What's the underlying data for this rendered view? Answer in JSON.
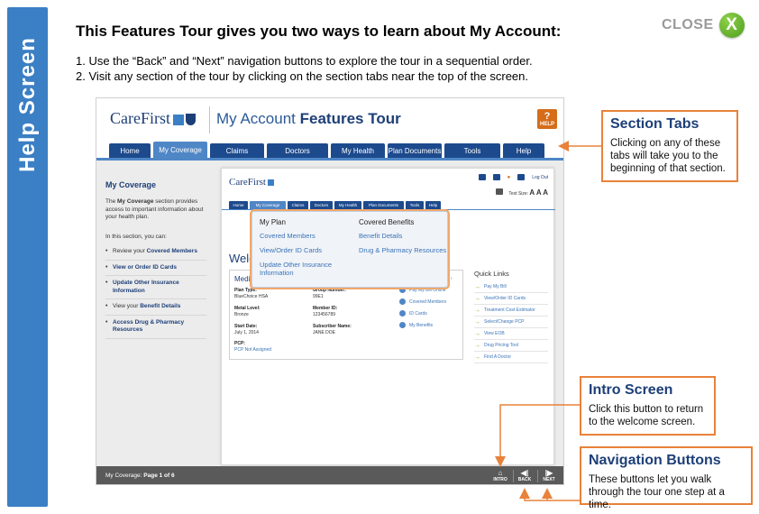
{
  "sidebar": {
    "vertical_title": "Help Screen"
  },
  "close": {
    "label": "CLOSE",
    "icon_glyph": "X"
  },
  "headline": "This Features Tour gives you two ways to learn about  My Account:",
  "instructions": [
    "1. Use the “Back” and “Next” navigation buttons to explore the tour in a sequential order.",
    "2. Visit any section of the tour by clicking on the section tabs near the top of the screen."
  ],
  "screenshot": {
    "logo": "CareFirst",
    "title_light": "My Account ",
    "title_bold": "Features Tour",
    "help_label": "HELP",
    "help_glyph": "?",
    "tabs": [
      {
        "label": "Home",
        "width": 46
      },
      {
        "label": "My Coverage",
        "width": 60,
        "active": true
      },
      {
        "label": "Claims",
        "width": 60
      },
      {
        "label": "Doctors",
        "width": 68
      },
      {
        "label": "My Health",
        "width": 60
      },
      {
        "label": "Plan Documents",
        "width": 60
      },
      {
        "label": "Tools",
        "width": 62
      },
      {
        "label": "Help",
        "width": 46
      }
    ],
    "left_panel": {
      "title": "My Coverage",
      "desc_prefix": "The ",
      "desc_bold": "My Coverage",
      "desc_suffix": " section provides access to important information about your health plan.",
      "can_text": "In this section, you can:",
      "bullets": [
        {
          "prefix": "Review your ",
          "bold": "Covered Members"
        },
        {
          "prefix": "",
          "bold": "View or Order ID Cards"
        },
        {
          "prefix": "",
          "bold": "Update Other Insurance Information"
        },
        {
          "prefix": "View your ",
          "bold": "Benefit Details"
        },
        {
          "prefix": "",
          "bold": "Access Drug & Pharmacy Resources"
        }
      ]
    },
    "mock": {
      "logo": "CareFirst",
      "logout": "Log Out",
      "text_size_label": "Text Size:",
      "text_size_values": "A A A",
      "tabs": [
        "Home",
        "My Coverage",
        "Claims",
        "Doctors",
        "My Health",
        "Plan Documents",
        "Tools",
        "Help"
      ],
      "dropdown": {
        "col1_head": "My Plan",
        "col1_links": [
          "Covered Members",
          "View/Order ID Cards",
          "Update Other Insurance Information"
        ],
        "col2_head": "Covered Benefits",
        "col2_links": [
          "Benefit Details",
          "Drug & Pharmacy Resources"
        ]
      },
      "welcome": "Welc",
      "card_title": "Medi",
      "card_more": "ails ›",
      "fields": [
        {
          "label": "Plan Type:",
          "value": "BlueChoice HSA"
        },
        {
          "label": "Group Number:",
          "value": "99E1"
        },
        {
          "label": "Metal Level:",
          "value": "Bronze"
        },
        {
          "label": "Member ID:",
          "value": "123456789"
        },
        {
          "label": "Start Date:",
          "value": "July 1, 2014"
        },
        {
          "label": "Subscriber Name:",
          "value": "JANE DOE"
        },
        {
          "label": "PCP:",
          "value": "PCP Not Assigned"
        }
      ],
      "actions": [
        "Pay My Bill Online",
        "Covered Members",
        "ID Cards",
        "My Benefits"
      ],
      "quick_links_title": "Quick Links",
      "quick_links": [
        "Pay My Bill",
        "View/Order ID Cards",
        "Treatment Cost Estimator",
        "Select/Change PCP",
        "View EOB",
        "Drug Pricing Tool",
        "Find A Doctor"
      ]
    },
    "bottom": {
      "page_prefix": "My Coverage: ",
      "page_bold": "Page 1 of 6",
      "intro": "INTRO",
      "back": "BACK",
      "next": "NEXT",
      "intro_glyph": "⌂",
      "back_glyph": "◀|",
      "next_glyph": "|▶"
    }
  },
  "callouts": {
    "section_tabs": {
      "title": "Section Tabs",
      "body": "Clicking on any of these tabs will take you to the beginning of that section."
    },
    "intro_screen": {
      "title": "Intro Screen",
      "body": "Click this button to return to the welcome screen."
    },
    "navigation": {
      "title": "Navigation Buttons",
      "body": "These buttons let you walk through the tour one step at a time."
    }
  },
  "colors": {
    "accent_blue": "#3b7fc4",
    "nav_blue": "#1d4a8d",
    "callout_orange": "#e8823a",
    "close_green": "#5fb12b"
  }
}
